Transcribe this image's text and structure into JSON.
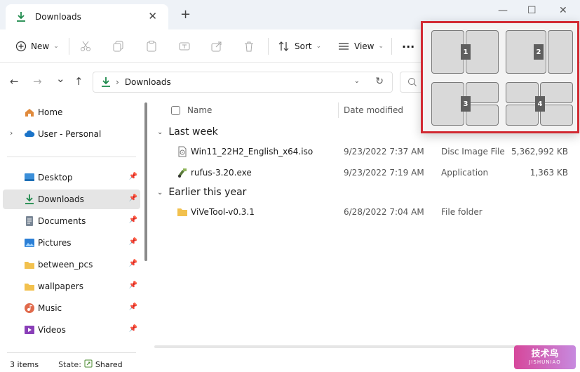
{
  "window": {
    "tab_title": "Downloads",
    "tab_close": "✕",
    "new_tab": "+",
    "minimize": "—",
    "maximize": "☐",
    "close": "✕"
  },
  "toolbar": {
    "new_label": "New",
    "sort_label": "Sort",
    "view_label": "View",
    "more_label": "···"
  },
  "nav": {
    "breadcrumb": "Downloads",
    "back": "←",
    "forward": "→",
    "recent": "⌄",
    "up": "↑",
    "search_placeholder": ""
  },
  "sidebar": {
    "items": [
      {
        "label": "Home"
      },
      {
        "label": "User - Personal"
      },
      {
        "label": "Desktop"
      },
      {
        "label": "Downloads"
      },
      {
        "label": "Documents"
      },
      {
        "label": "Pictures"
      },
      {
        "label": "between_pcs"
      },
      {
        "label": "wallpapers"
      },
      {
        "label": "Music"
      },
      {
        "label": "Videos"
      }
    ]
  },
  "columns": {
    "name": "Name",
    "date_modified": "Date modified"
  },
  "groups": [
    {
      "label": "Last week",
      "files": [
        {
          "name": "Win11_22H2_English_x64.iso",
          "date": "9/23/2022 7:37 AM",
          "type": "Disc Image File",
          "size": "5,362,992 KB",
          "icon": "disc-image-file-icon"
        },
        {
          "name": "rufus-3.20.exe",
          "date": "9/23/2022 7:19 AM",
          "type": "Application",
          "size": "1,363 KB",
          "icon": "application-icon"
        }
      ]
    },
    {
      "label": "Earlier this year",
      "files": [
        {
          "name": "ViVeTool-v0.3.1",
          "date": "6/28/2022 7:04 AM",
          "type": "File folder",
          "size": "",
          "icon": "folder-icon"
        }
      ]
    }
  ],
  "status": {
    "count": "3 items",
    "state_label": "State:",
    "state_value": "Shared"
  },
  "snap_layouts": {
    "badges": [
      "1",
      "2",
      "3",
      "4"
    ]
  },
  "watermark": {
    "main": "技术鸟",
    "sub": "JISHUNIAO"
  },
  "colors": {
    "accent_green": "#1e8a4c",
    "snap_border": "#d22a33",
    "folder": "#f2c14e"
  }
}
